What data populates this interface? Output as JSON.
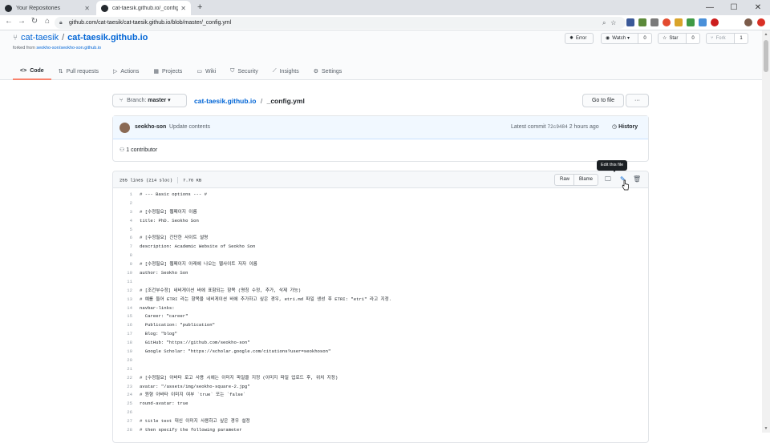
{
  "browser": {
    "tabs": [
      {
        "title": "Your Repositories",
        "active": false
      },
      {
        "title": "cat-taesik.github.io/_config.yml",
        "active": true
      }
    ],
    "url": "github.com/cat-taesik/cat-taesik.github.io/blob/master/_config.yml"
  },
  "repo": {
    "owner": "cat-taesik",
    "separator": "/",
    "name": "cat-taesik.github.io",
    "forked_prefix": "forked from",
    "forked_from": "seokho-son/seokho-son.github.io",
    "buttons": {
      "error": "Error",
      "watch": "Watch",
      "watch_count": "0",
      "star": "Star",
      "star_count": "0",
      "fork": "Fork",
      "fork_count": "1"
    },
    "nav": [
      {
        "label": "Code",
        "icon": "code-icon",
        "selected": true
      },
      {
        "label": "Pull requests",
        "icon": "pull-request-icon",
        "selected": false
      },
      {
        "label": "Actions",
        "icon": "play-icon",
        "selected": false
      },
      {
        "label": "Projects",
        "icon": "project-icon",
        "selected": false
      },
      {
        "label": "Wiki",
        "icon": "book-icon",
        "selected": false
      },
      {
        "label": "Security",
        "icon": "shield-icon",
        "selected": false
      },
      {
        "label": "Insights",
        "icon": "graph-icon",
        "selected": false
      },
      {
        "label": "Settings",
        "icon": "gear-icon",
        "selected": false
      }
    ]
  },
  "file_nav": {
    "branch_prefix": "Branch:",
    "branch": "master",
    "crumb_repo": "cat-taesik.github.io",
    "crumb_sep": "/",
    "crumb_file": "_config.yml",
    "go_to_file": "Go to file",
    "more": "···"
  },
  "commit": {
    "author": "seokho-son",
    "message": "Update contents",
    "latest_label": "Latest commit",
    "sha": "72c9484",
    "time": "2 hours ago",
    "history": "History",
    "contributors": "1 contributor"
  },
  "file": {
    "lines_info": "255 lines (214 sloc)",
    "size": "7.76 KB",
    "raw": "Raw",
    "blame": "Blame",
    "tooltip": "Edit this file",
    "code": [
      {
        "n": "1",
        "t": "# --- Basic options --- #"
      },
      {
        "n": "2",
        "t": ""
      },
      {
        "n": "3",
        "t": "# [수정필요] 웹페이지 이름"
      },
      {
        "n": "4",
        "t": "title: PhD. Seokho Son"
      },
      {
        "n": "5",
        "t": ""
      },
      {
        "n": "6",
        "t": "# [수정필요] 간단한 사이트 설명"
      },
      {
        "n": "7",
        "t": "description: Academic Website of Seokho Son"
      },
      {
        "n": "8",
        "t": ""
      },
      {
        "n": "9",
        "t": "# [수정필요] 웹페이지 아래에 나오는 웹사이트 저자 이름"
      },
      {
        "n": "10",
        "t": "author: Seokho Son"
      },
      {
        "n": "11",
        "t": ""
      },
      {
        "n": "12",
        "t": "# [조건부수정] 네비게이션 바에 표함되는 항목 (명칭 수정, 추가, 삭제 가능)"
      },
      {
        "n": "13",
        "t": "# 예를 들어 ETRI 라는 항목을 네비게이션 바에 추가하고 싶은 경우, etri.md 파일 생성 후 ETRI: \"etri\" 라고 지정."
      },
      {
        "n": "14",
        "t": "navbar-links:"
      },
      {
        "n": "15",
        "t": "  Career: \"career\""
      },
      {
        "n": "16",
        "t": "  Publication: \"publication\""
      },
      {
        "n": "17",
        "t": "  Blog: \"blog\""
      },
      {
        "n": "18",
        "t": "  GitHub: \"https://github.com/seokho-son\""
      },
      {
        "n": "19",
        "t": "  Google Scholar: \"https://scholar.google.com/citations?user=seokhoson\""
      },
      {
        "n": "20",
        "t": ""
      },
      {
        "n": "21",
        "t": ""
      },
      {
        "n": "22",
        "t": "# [수정필요] 아바타 로고 사용 시에는 이미지 파일을 지정 (이미지 파일 업로드 후, 위치 지정)"
      },
      {
        "n": "23",
        "t": "avatar: \"/assets/img/seokho-square-2.jpg\""
      },
      {
        "n": "24",
        "t": "# 원형 아바타 이미지 여부 `true` 또는 `false`"
      },
      {
        "n": "25",
        "t": "round-avatar: true"
      },
      {
        "n": "26",
        "t": ""
      },
      {
        "n": "27",
        "t": "# title text 대신 이미지 사용하고 싶은 경우 설정"
      },
      {
        "n": "28",
        "t": "# then specify the following parameter"
      }
    ]
  },
  "colors": {
    "link": "#0366d6",
    "selected_tab_border": "#f9826c",
    "commit_bg": "#f1f8ff"
  }
}
